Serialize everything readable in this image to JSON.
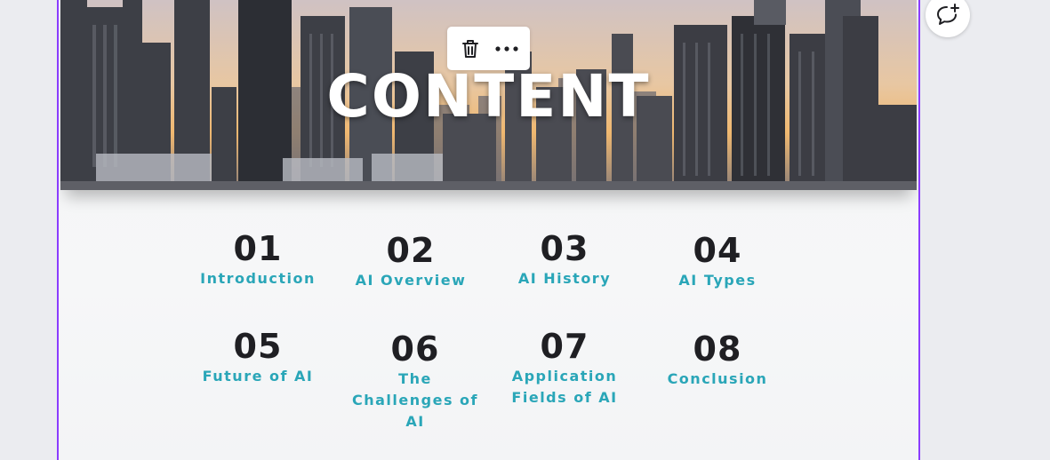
{
  "slide": {
    "title": "CONTENT",
    "items": [
      {
        "number": "01",
        "label": "Introduction"
      },
      {
        "number": "02",
        "label": "AI Overview"
      },
      {
        "number": "03",
        "label": "AI History"
      },
      {
        "number": "04",
        "label": "AI Types"
      },
      {
        "number": "05",
        "label": "Future of AI"
      },
      {
        "number": "06",
        "label": "The Challenges of AI"
      },
      {
        "number": "07",
        "label": "Application Fields of AI"
      },
      {
        "number": "08",
        "label": "Conclusion"
      }
    ]
  },
  "toolbar": {
    "delete_icon": "trash-icon",
    "more_icon": "more-horizontal-icon"
  },
  "comment": {
    "icon": "add-comment-icon"
  },
  "colors": {
    "selection_border": "#8b3dff",
    "number_text": "#1f1f23",
    "label_text": "#2aa6b8"
  }
}
